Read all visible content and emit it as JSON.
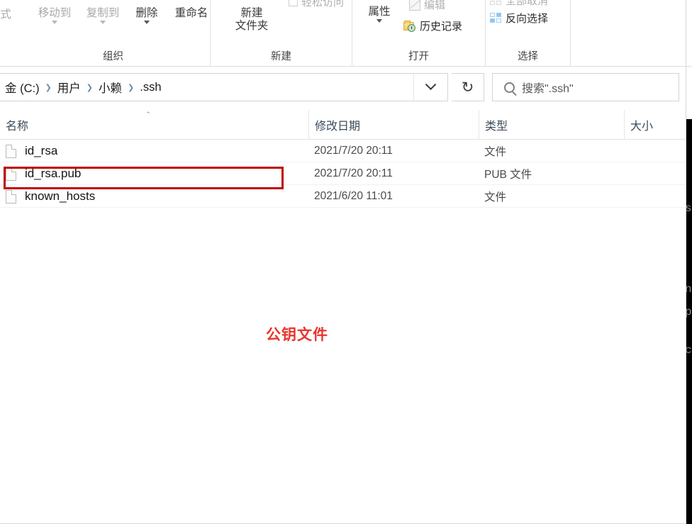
{
  "ribbon": {
    "cut_off_left_label": "式",
    "groups": [
      {
        "name": "organize",
        "label": "组织",
        "buttons": [
          {
            "label": "移动到",
            "has_dropdown": true,
            "disabled": true
          },
          {
            "label": "复制到",
            "has_dropdown": true,
            "disabled": true
          },
          {
            "label": "删除",
            "has_dropdown": true,
            "disabled": false
          },
          {
            "label": "重命名",
            "has_dropdown": false,
            "disabled": false
          }
        ]
      },
      {
        "name": "new",
        "label": "新建",
        "buttons": [
          {
            "label": "新建\n文件夹",
            "line1": "新建",
            "line2": "文件夹",
            "has_dropdown": false,
            "disabled": false
          }
        ],
        "small_items": [
          {
            "label": "轻松访问",
            "icon": "checkbox-icon",
            "disabled": true
          }
        ]
      },
      {
        "name": "open",
        "label": "打开",
        "buttons": [
          {
            "label": "属性",
            "has_dropdown": true,
            "disabled": false
          }
        ],
        "small_items": [
          {
            "label": "编辑",
            "icon": "edit-icon",
            "disabled": true
          },
          {
            "label": "历史记录",
            "icon": "history-icon",
            "disabled": false
          }
        ]
      },
      {
        "name": "select",
        "label": "选择",
        "small_items": [
          {
            "label": "全部取消",
            "icon": "deselect-all-icon",
            "disabled": true
          },
          {
            "label": "反向选择",
            "icon": "invert-selection-icon",
            "disabled": false
          }
        ]
      }
    ]
  },
  "address_bar": {
    "breadcrumbs": [
      "金 (C:)",
      "用户",
      "小赖",
      ".ssh"
    ],
    "separator": "❯",
    "dropdown_icon": "chevron-down-icon",
    "refresh_icon": "↻",
    "search": {
      "icon": "search-icon",
      "placeholder": "搜索\".ssh\"",
      "value": ""
    }
  },
  "columns": [
    {
      "label": "名称",
      "sort": "asc",
      "sort_glyph": "ˆ"
    },
    {
      "label": "修改日期",
      "sort": "none"
    },
    {
      "label": "类型",
      "sort": "none"
    },
    {
      "label": "大小",
      "sort": "none"
    }
  ],
  "files": [
    {
      "icon": "file-icon",
      "name": "id_rsa",
      "modified": "2021/7/20 20:11",
      "type": "文件",
      "size": ""
    },
    {
      "icon": "file-icon",
      "name": "id_rsa.pub",
      "modified": "2021/7/20 20:11",
      "type": "PUB 文件",
      "size": ""
    },
    {
      "icon": "file-icon",
      "name": "known_hosts",
      "modified": "2021/6/20 11:01",
      "type": "文件",
      "size": ""
    }
  ],
  "annotations": {
    "highlight_row_index": 1,
    "highlight_color": "#c00000",
    "note_text": "公钥文件",
    "note_color": "#e8342c"
  },
  "background_window": {
    "color": "#000000",
    "partial_glyphs": [
      "s",
      "n",
      "p",
      "c"
    ]
  }
}
